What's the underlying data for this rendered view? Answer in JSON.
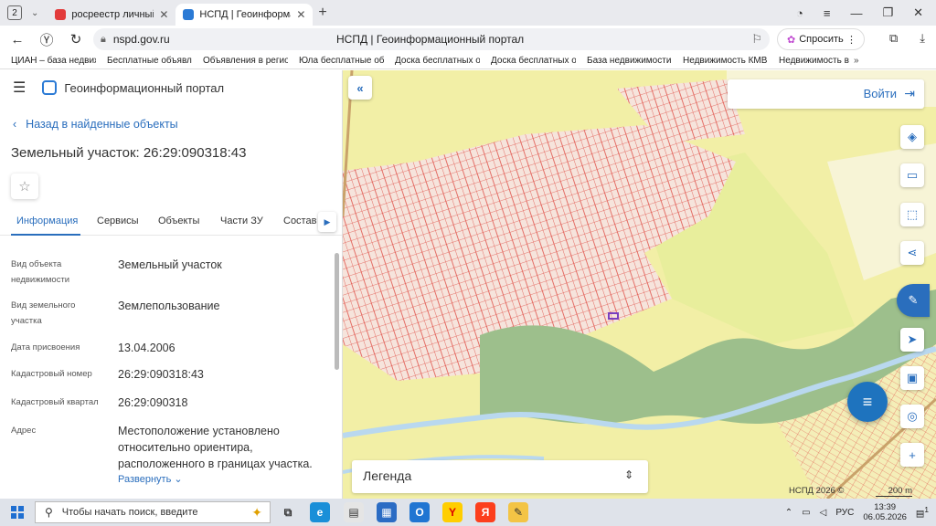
{
  "browser": {
    "tab_count": "2",
    "tabs": [
      {
        "title": "росреестр личный кабинет",
        "favicon_color": "#e23b3b"
      },
      {
        "title": "НСПД | Геоинформационный портал",
        "favicon_color": "#2a7ad5"
      }
    ],
    "url": "nspd.gov.ru",
    "page_title": "НСПД | Геоинформационный портал",
    "ask_button": "Спросить",
    "bookmarks": [
      "ЦИАН – база недвижимости",
      "Бесплатные объявления",
      "Объявления в регионе",
      "Юла бесплатные объявления",
      "Доска бесплатных объявлений",
      "Доска бесплатных объявлений",
      "База недвижимости",
      "Недвижимость КМВ",
      "Недвижимость в Ставрополе"
    ]
  },
  "panel": {
    "app_name": "Геоинформационный портал",
    "back_link": "Назад в найденные объекты",
    "object_title": "Земельный участок: 26:29:090318:43",
    "tabs": [
      "Информация",
      "Сервисы",
      "Объекты",
      "Части ЗУ",
      "Состав"
    ],
    "properties": [
      {
        "label": "Вид объекта недвижимости",
        "value": "Земельный участок"
      },
      {
        "label": "Вид земельного участка",
        "value": "Землепользование"
      },
      {
        "label": "Дата присвоения",
        "value": "13.04.2006"
      },
      {
        "label": "Кадастровый номер",
        "value": "26:29:090318:43"
      },
      {
        "label": "Кадастровый квартал",
        "value": "26:29:090318"
      },
      {
        "label": "Адрес",
        "value": "Местоположение установлено относительно ориентира, расположенного в границах участка."
      }
    ],
    "expand_label": "Развернуть"
  },
  "map": {
    "login_label": "Войти",
    "legend_label": "Легенда",
    "copyright": "НСПД 2026 ©",
    "scale_label": "200 m",
    "colors": {
      "base": "#f2efa6",
      "parcel": "#e0524a",
      "forest": "#9dbf8c",
      "river": "#b9d8ef",
      "accent": "#2a6ebd"
    }
  },
  "taskbar": {
    "search_placeholder": "Чтобы начать поиск, введите",
    "lang": "РУС",
    "time": "13:39",
    "date": "06.05.2026",
    "notif_count": "1"
  }
}
